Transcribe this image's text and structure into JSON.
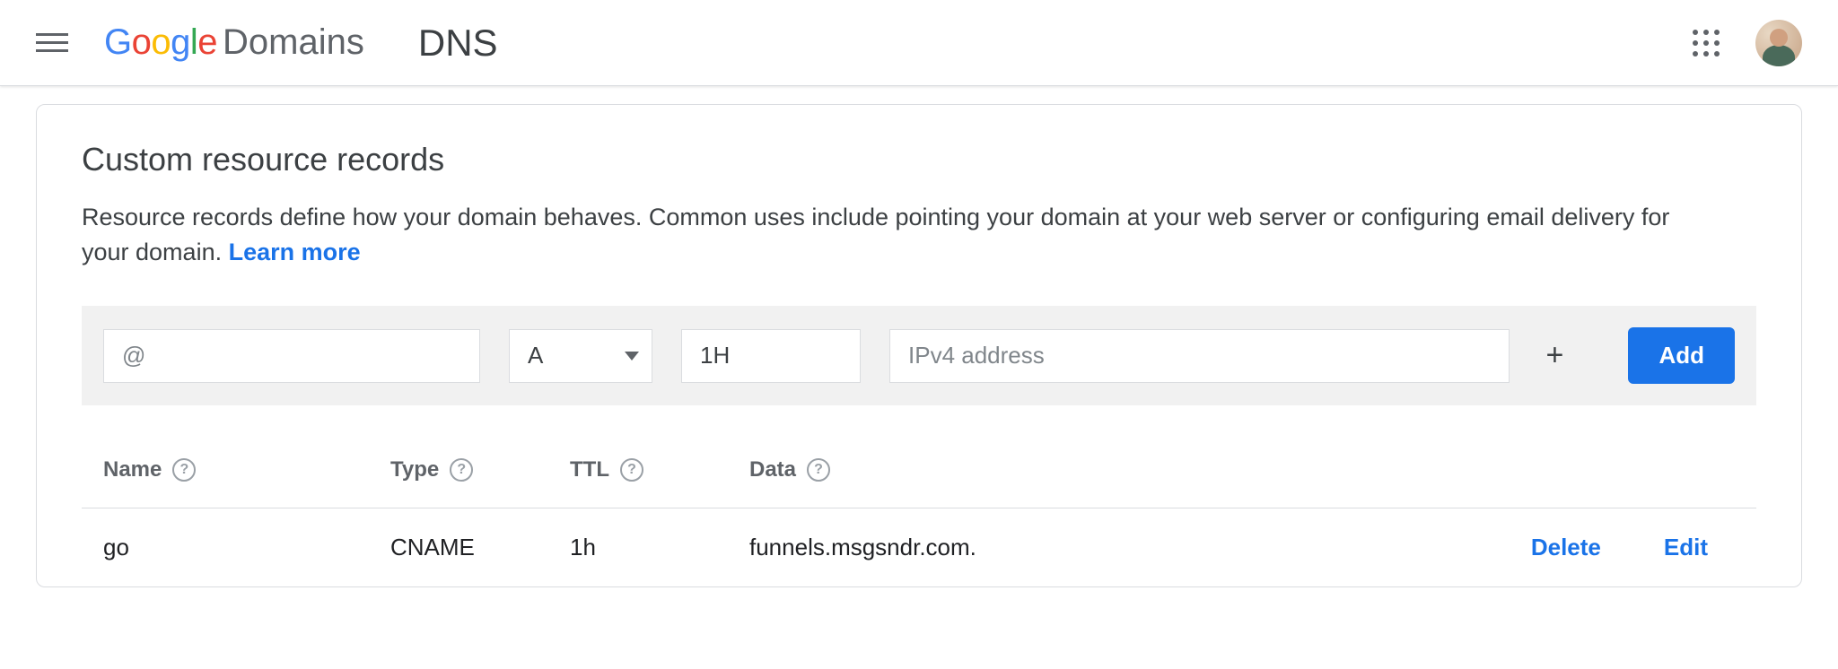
{
  "header": {
    "product": "Domains",
    "page": "DNS"
  },
  "card": {
    "title": "Custom resource records",
    "description_prefix": "Resource records define how your domain behaves. Common uses include pointing your domain at your web server or configuring email delivery for your domain. ",
    "learn_more": "Learn more"
  },
  "add_row": {
    "name_placeholder": "@",
    "name_value": "",
    "type_value": "A",
    "ttl_value": "1H",
    "data_placeholder": "IPv4 address",
    "data_value": "",
    "plus_label": "+",
    "add_label": "Add"
  },
  "table": {
    "headers": {
      "name": "Name",
      "type": "Type",
      "ttl": "TTL",
      "data": "Data"
    },
    "rows": [
      {
        "name": "go",
        "type": "CNAME",
        "ttl": "1h",
        "data": "funnels.msgsndr.com.",
        "delete": "Delete",
        "edit": "Edit"
      }
    ]
  }
}
